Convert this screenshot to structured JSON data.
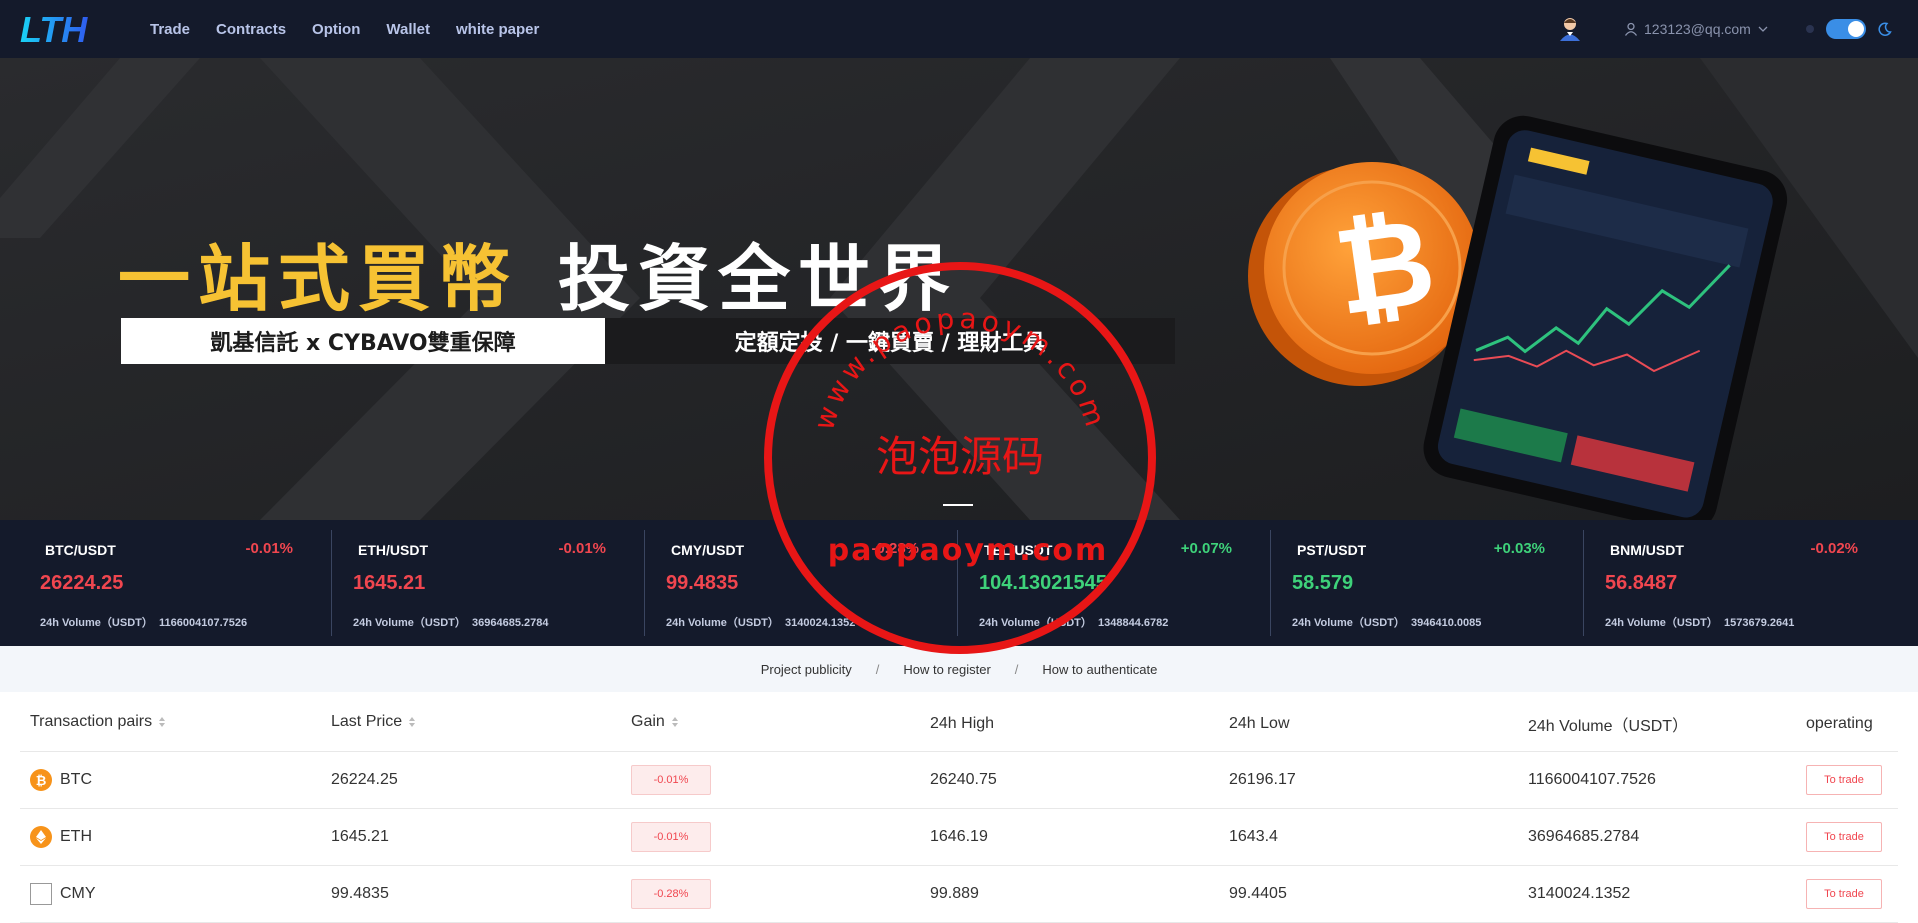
{
  "header": {
    "logo_text": "LTH",
    "nav": [
      "Trade",
      "Contracts",
      "Option",
      "Wallet",
      "white paper"
    ],
    "account_email": "123123@qq.com"
  },
  "banner": {
    "headline_yellow": "一站式買幣",
    "headline_white": "投資全世界",
    "sub_left": "凱基信託 x CYBAVO雙重保障",
    "sub_right": "定額定投 / 一鍵買賣 / 理財工具"
  },
  "watermark": {
    "arc_text": "www.paopaoym.com",
    "center_text": "泡泡源码",
    "bottom_text": "paopaoym.com"
  },
  "tickers": [
    {
      "pair": "BTC/USDT",
      "gain": "-0.01%",
      "price": "26224.25",
      "volume_label": "24h Volume（USDT）",
      "volume": "1166004107.7526",
      "trend": "down"
    },
    {
      "pair": "ETH/USDT",
      "gain": "-0.01%",
      "price": "1645.21",
      "volume_label": "24h Volume（USDT）",
      "volume": "36964685.2784",
      "trend": "down"
    },
    {
      "pair": "CMY/USDT",
      "gain": "-0.28%",
      "price": "99.4835",
      "volume_label": "24h Volume（USDT）",
      "volume": "3140024.1352",
      "trend": "down"
    },
    {
      "pair": "TEL/USDT",
      "gain": "+0.07%",
      "price": "104.13021545",
      "volume_label": "24h Volume（USDT）",
      "volume": "1348844.6782",
      "trend": "up"
    },
    {
      "pair": "PST/USDT",
      "gain": "+0.03%",
      "price": "58.579",
      "volume_label": "24h Volume（USDT）",
      "volume": "3946410.0085",
      "trend": "up"
    },
    {
      "pair": "BNM/USDT",
      "gain": "-0.02%",
      "price": "56.8487",
      "volume_label": "24h Volume（USDT）",
      "volume": "1573679.2641",
      "trend": "down"
    }
  ],
  "links": {
    "project": "Project publicity",
    "register": "How to register",
    "authenticate": "How to authenticate",
    "separator": "/"
  },
  "table": {
    "headers": {
      "pair": "Transaction pairs",
      "last": "Last Price",
      "gain": "Gain",
      "high": "24h High",
      "low": "24h Low",
      "volume": "24h Volume（USDT）",
      "operating": "operating"
    },
    "rows": [
      {
        "coin": "BTC",
        "icon": "bitcoin-icon",
        "last": "26224.25",
        "gain": "-0.01%",
        "high": "26240.75",
        "low": "26196.17",
        "volume": "1166004107.7526",
        "action": "To trade"
      },
      {
        "coin": "ETH",
        "icon": "ethereum-icon",
        "last": "1645.21",
        "gain": "-0.01%",
        "high": "1646.19",
        "low": "1643.4",
        "volume": "36964685.2784",
        "action": "To trade"
      },
      {
        "coin": "CMY",
        "icon": "broken-image-icon",
        "last": "99.4835",
        "gain": "-0.28%",
        "high": "99.889",
        "low": "99.4405",
        "volume": "3140024.1352",
        "action": "To trade"
      }
    ]
  },
  "colors": {
    "header_bg": "#141a2b",
    "up": "#3ed27a",
    "down": "#f0464f",
    "brand_yellow": "#f6c233"
  }
}
